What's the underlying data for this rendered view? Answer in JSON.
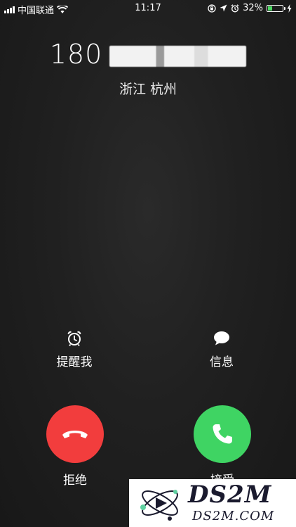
{
  "status_bar": {
    "carrier": "中国联通",
    "time": "11:17",
    "battery_percent": "32%",
    "battery_level": 0.32,
    "icons": [
      "signal-icon",
      "wifi-icon",
      "lock-rotation-icon",
      "location-icon",
      "alarm-icon",
      "battery-icon",
      "charging-icon"
    ]
  },
  "caller": {
    "number_prefix": "180",
    "location": "浙江 杭州"
  },
  "options": {
    "remind_label": "提醒我",
    "message_label": "信息"
  },
  "actions": {
    "decline_label": "拒绝",
    "accept_label": "接受"
  },
  "colors": {
    "decline": "#f23d3d",
    "accept": "#3fd463",
    "background": "#1e1e1e"
  },
  "watermark": {
    "title": "DS2M",
    "subtitle": "DS2M.COM"
  }
}
